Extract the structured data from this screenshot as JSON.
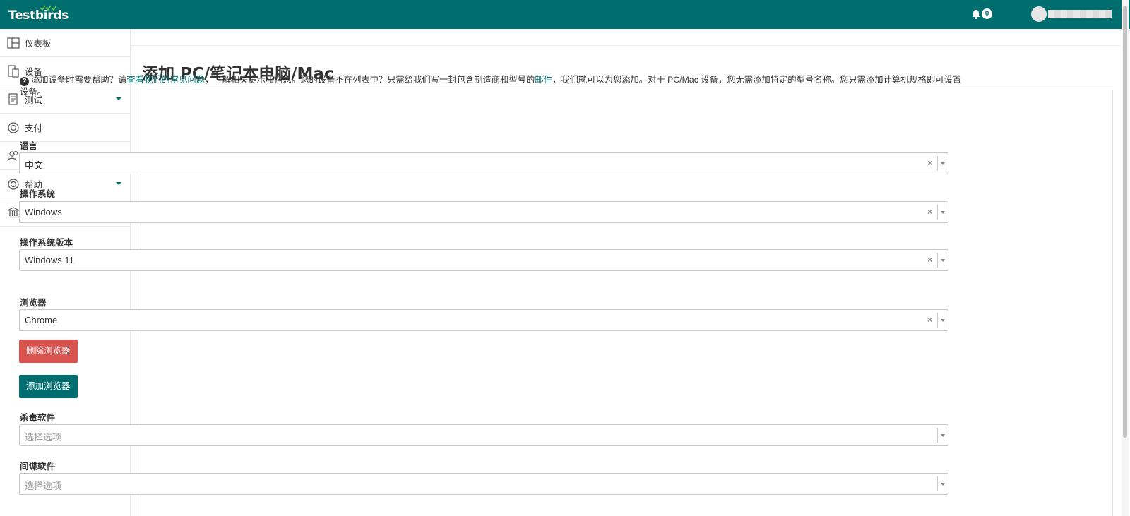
{
  "header": {
    "logo_text": "Testbirds",
    "notifications_count": "0",
    "colors": {
      "brand": "#006d6f",
      "danger": "#d9534f"
    }
  },
  "sidebar": {
    "items": [
      {
        "label": "仪表板",
        "icon": "dashboard-icon",
        "has_submenu": false
      },
      {
        "label": "设备",
        "icon": "devices-icon",
        "has_submenu": false
      },
      {
        "label": "测试",
        "icon": "tests-icon",
        "has_submenu": true
      },
      {
        "label": "支付",
        "icon": "payment-icon",
        "has_submenu": false
      },
      {
        "label": "社区",
        "icon": "community-icon",
        "has_submenu": true
      },
      {
        "label": "帮助",
        "icon": "help-icon",
        "has_submenu": true
      },
      {
        "label": "法律",
        "icon": "legal-icon",
        "has_submenu": true
      }
    ]
  },
  "page": {
    "title": "添加 PC/笔记本电脑/Mac",
    "help": {
      "part1": "添加设备时需要帮助？请",
      "link_faq": "查看我们的常见问题",
      "part2": "，了解相关提示和信息。您的设备不在列表中？只需给我们写一封包含制造商和型号的",
      "link_mail": "邮件",
      "part3": "，我们就可以为您添加。对于 PC/Mac 设备，您无需添加特定的型号名称。您只需添加计算机规格即可设置",
      "part4": "设备。"
    },
    "fields": {
      "language": {
        "label": "语言",
        "value": "中文"
      },
      "os": {
        "label": "操作系统",
        "value": "Windows"
      },
      "os_version": {
        "label": "操作系统版本",
        "value": "Windows 11"
      },
      "browser": {
        "label": "浏览器",
        "value": "Chrome"
      },
      "antivirus": {
        "label": "杀毒软件",
        "placeholder": "选择选项"
      },
      "spyware": {
        "label": "间谍软件",
        "placeholder": "选择选项"
      }
    },
    "buttons": {
      "remove_browser": "删除浏览器",
      "add_browser": "添加浏览器"
    },
    "clear_symbol": "×"
  }
}
